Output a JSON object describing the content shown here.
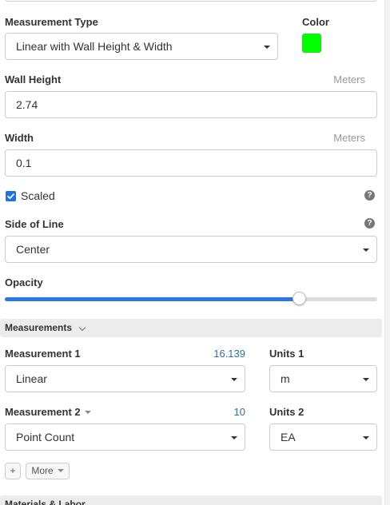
{
  "measurement_type": {
    "label": "Measurement Type",
    "value": "Linear with Wall Height & Width"
  },
  "color": {
    "label": "Color",
    "swatch_hex": "#00ff00"
  },
  "wall_height": {
    "label": "Wall Height",
    "unit": "Meters",
    "value": "2.74"
  },
  "width": {
    "label": "Width",
    "unit": "Meters",
    "value": "0.1"
  },
  "scaled": {
    "label": "Scaled",
    "checked": true,
    "help": "?"
  },
  "side_of_line": {
    "label": "Side of Line",
    "value": "Center",
    "help": "?"
  },
  "opacity": {
    "label": "Opacity",
    "level_fraction": 0.79
  },
  "measurements_section": {
    "title": "Measurements",
    "rows": [
      {
        "label": "Measurement 1",
        "value": "16.139",
        "type": "Linear",
        "units_label": "Units 1",
        "units": "m"
      },
      {
        "label": "Measurement 2",
        "value": "10",
        "type": "Point Count",
        "units_label": "Units 2",
        "units": "EA"
      }
    ],
    "add_button": "+",
    "more_button": "More"
  },
  "materials_section": {
    "title": "Materials & Labor"
  },
  "accent": "#2b78e4"
}
